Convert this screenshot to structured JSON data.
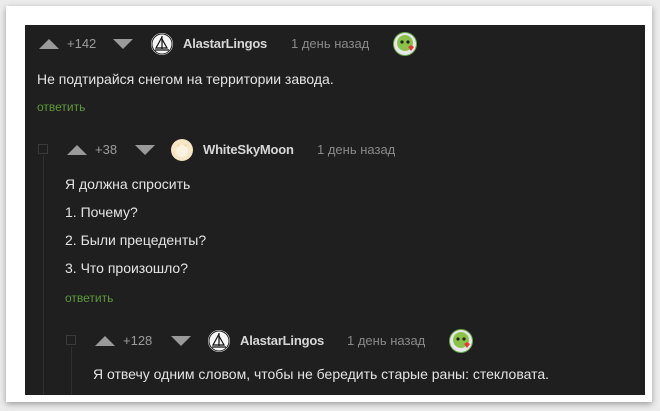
{
  "comments": [
    {
      "rating": "+142",
      "author": "AlastarLingos",
      "time": "1 день назад",
      "lines": [
        "Не подтирайся снегом на территории завода."
      ],
      "reply": "ответить"
    },
    {
      "rating": "+38",
      "author": "WhiteSkyMoon",
      "time": "1 день назад",
      "lines": [
        "Я должна спросить",
        "1. Почему?",
        "2. Были прецеденты?",
        "3. Что произошло?"
      ],
      "reply": "ответить"
    },
    {
      "rating": "+128",
      "author": "AlastarLingos",
      "time": "1 день назад",
      "lines": [
        "Я отвечу одним словом, чтобы не бередить старые раны: стекловата."
      ]
    }
  ],
  "icons": {
    "upvote": "triangle-up-icon",
    "downvote": "triangle-down-icon",
    "author_badge": "award-badge-icon"
  },
  "colors": {
    "background": "#1f1f1f",
    "reply_link": "#5f9a3c"
  }
}
